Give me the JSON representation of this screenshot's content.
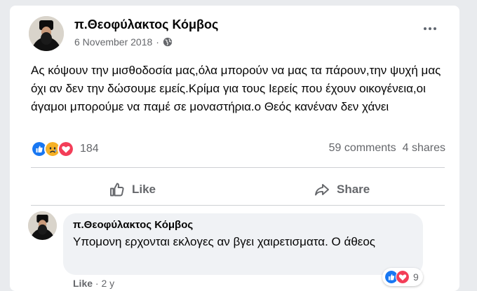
{
  "post": {
    "author": "π.Θεοφύλακτος Κόμβος",
    "date": "6 November 2018",
    "separator": "·",
    "audience_icon": "globe-icon",
    "text": "Ας κόψουν την μισθοδοσία μας,όλα μπορούν να μας τα πάρουν,την ψυχή μας όχι αν δεν την δώσουμε εμείς.Κρίμα για τους Ιερείς που έχουν οικογένεια,οι άγαμοι μπορούμε να παμέ σε μοναστήρια.ο Θεός κανέναν δεν χάνει",
    "reactions": {
      "types": [
        "like-icon",
        "sad-icon",
        "love-icon"
      ],
      "count": "184"
    },
    "comments_count": "59 comments",
    "shares_count": "4 shares"
  },
  "actions": {
    "like_label": "Like",
    "share_label": "Share"
  },
  "comment": {
    "author": "π.Θεοφύλακτος Κόμβος",
    "text": "Υπομονη ερχονται εκλογες αν βγει χαιρετισματα. Ο άθεος",
    "reactions": {
      "types": [
        "like-icon",
        "love-icon"
      ],
      "count": "9"
    },
    "like_label": "Like",
    "separator": "·",
    "age": "2 y"
  },
  "colors": {
    "like_blue": "#1877f2",
    "love_red": "#f33e58",
    "sad_yellow": "#f7b125",
    "secondary_text": "#65676b"
  }
}
